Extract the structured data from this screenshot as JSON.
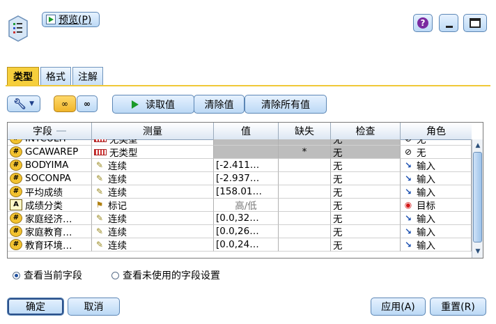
{
  "toolbar": {
    "preview_label": "预览(P)",
    "preview_mnemonic": "P"
  },
  "tabs": [
    "类型",
    "格式",
    "注解"
  ],
  "actions": {
    "read_values": "读取值",
    "clear_values": "清除值",
    "clear_all_values": "清除所有值"
  },
  "table": {
    "headers": [
      "字段",
      "测量",
      "值",
      "缺失",
      "检查",
      "角色"
    ],
    "rows": [
      {
        "field": "INTCULTP",
        "measure": "无类型",
        "value": "",
        "missing": "",
        "check": "无",
        "role": "无",
        "field_icon": "hash",
        "measure_icon": "typeless",
        "role_icon": "none"
      },
      {
        "field": "GCAWAREP",
        "measure": "无类型",
        "value": "",
        "missing": "*",
        "check": "无",
        "role": "无",
        "field_icon": "hash",
        "measure_icon": "typeless",
        "role_icon": "none"
      },
      {
        "field": "BODYIMA",
        "measure": "连续",
        "value": "[-2.411…",
        "missing": "",
        "check": "无",
        "role": "输入",
        "field_icon": "hash",
        "measure_icon": "ruler",
        "role_icon": "input"
      },
      {
        "field": "SOCONPA",
        "measure": "连续",
        "value": "[-2.937…",
        "missing": "",
        "check": "无",
        "role": "输入",
        "field_icon": "hash",
        "measure_icon": "ruler",
        "role_icon": "input"
      },
      {
        "field": "平均成绩",
        "measure": "连续",
        "value": "[158.01…",
        "missing": "",
        "check": "无",
        "role": "输入",
        "field_icon": "hash",
        "measure_icon": "ruler",
        "role_icon": "input"
      },
      {
        "field": "成绩分类",
        "measure": "标记",
        "value": "高/低",
        "missing": "",
        "check": "无",
        "role": "目标",
        "field_icon": "A",
        "measure_icon": "flag",
        "role_icon": "target"
      },
      {
        "field": "家庭经济…",
        "measure": "连续",
        "value": "[0.0,32…",
        "missing": "",
        "check": "无",
        "role": "输入",
        "field_icon": "hash",
        "measure_icon": "ruler",
        "role_icon": "input"
      },
      {
        "field": "家庭教育…",
        "measure": "连续",
        "value": "[0.0,26…",
        "missing": "",
        "check": "无",
        "role": "输入",
        "field_icon": "hash",
        "measure_icon": "ruler",
        "role_icon": "input"
      },
      {
        "field": "教育环境…",
        "measure": "连续",
        "value": "[0.0,24…",
        "missing": "",
        "check": "无",
        "role": "输入",
        "field_icon": "hash",
        "measure_icon": "ruler",
        "role_icon": "input"
      }
    ]
  },
  "view_options": {
    "current_fields": "查看当前字段",
    "unused_settings": "查看未使用的字段设置"
  },
  "footer": {
    "ok": "确定",
    "cancel": "取消",
    "apply": "应用(A)",
    "reset": "重置(R)"
  }
}
